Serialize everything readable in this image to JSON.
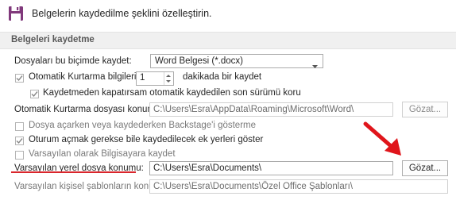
{
  "header": {
    "icon": "save-disk-icon",
    "title": "Belgelerin kaydedilme şeklini özelleştirin."
  },
  "section": {
    "title": "Belgeleri kaydetme"
  },
  "format_row": {
    "label": "Dosyaları bu biçimde kaydet:",
    "value": "Word Belgesi (*.docx)"
  },
  "autorecover_row": {
    "label": "Otomatik Kurtarma bilgilerini",
    "checked": true,
    "minutes": "1",
    "suffix": "dakikada bir kaydet"
  },
  "keep_last_row": {
    "label": "Kaydetmeden kapatırsam otomatik kaydedilen son sürümü koru",
    "checked": true
  },
  "autorecover_location": {
    "label": "Otomatik Kurtarma dosyası konumu:",
    "value": "C:\\Users\\Esra\\AppData\\Roaming\\Microsoft\\Word\\",
    "browse": "Gözat..."
  },
  "backstage_row": {
    "label": "Dosya açarken veya kaydederken Backstage'i gösterme",
    "checked": false
  },
  "signin_row": {
    "label": "Oturum açmak gerekse bile kaydedilecek ek yerleri göster",
    "checked": true
  },
  "default_pc_row": {
    "label": "Varsayılan olarak Bilgisayara kaydet",
    "checked": false
  },
  "local_location": {
    "label": "Varsayılan yerel dosya konumu:",
    "value": "C:\\Users\\Esra\\Documents\\",
    "browse": "Gözat..."
  },
  "templates_location": {
    "label": "Varsayılan kişisel şablonların konumu:",
    "value": "C:\\Users\\Esra\\Documents\\Özel Office Şablonları\\"
  },
  "colors": {
    "icon_purple": "#80397b",
    "arrow_red": "#e0151b",
    "underline_red": "#d9262c"
  }
}
